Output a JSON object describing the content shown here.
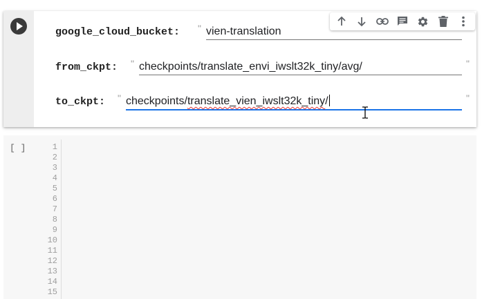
{
  "form_cell": {
    "fields": [
      {
        "label": "google_cloud_bucket:",
        "open_quote": "\"",
        "value": "vien-translation",
        "close_quote": "\""
      },
      {
        "label": "from_ckpt:",
        "open_quote": "\"",
        "value": "checkpoints/translate_envi_iwslt32k_tiny/avg/",
        "close_quote": "\""
      },
      {
        "label": "to_ckpt:",
        "open_quote": "\"",
        "value_prefix": "checkpoints/",
        "value_misspelled": "translate_vien_iwslt32k_tiny",
        "value_suffix": "/",
        "close_quote": "\""
      }
    ]
  },
  "toolbar": {
    "icons": [
      "arrow-up-icon",
      "arrow-down-icon",
      "link-icon",
      "comment-icon",
      "gear-icon",
      "trash-icon",
      "more-vert-icon"
    ]
  },
  "code_cell": {
    "exec_count": "[ ]",
    "line_numbers": [
      "1",
      "2",
      "3",
      "4",
      "5",
      "6",
      "7",
      "8",
      "9",
      "10",
      "11",
      "12",
      "13",
      "14",
      "15"
    ]
  },
  "colors": {
    "accent": "#1a73e8",
    "spell_error": "#e53935",
    "gutter": "#eeeeee",
    "code_bg": "#f7f7f7"
  }
}
